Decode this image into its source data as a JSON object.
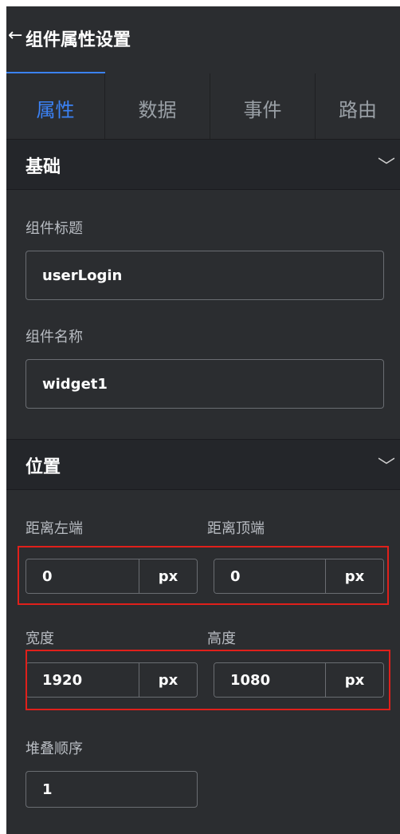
{
  "header": {
    "back_icon": "←",
    "title": "组件属性设置"
  },
  "tabs": [
    {
      "label": "属性",
      "active": true
    },
    {
      "label": "数据",
      "active": false
    },
    {
      "label": "事件",
      "active": false
    },
    {
      "label": "路由",
      "active": false
    }
  ],
  "sections": {
    "basic": {
      "title": "基础",
      "chevron": "﹀",
      "component_title_label": "组件标题",
      "component_title_value": "userLogin",
      "component_name_label": "组件名称",
      "component_name_value": "widget1"
    },
    "position": {
      "title": "位置",
      "chevron": "﹀",
      "left_label": "距离左端",
      "left_value": "0",
      "left_unit": "px",
      "top_label": "距离顶端",
      "top_value": "0",
      "top_unit": "px",
      "width_label": "宽度",
      "width_value": "1920",
      "width_unit": "px",
      "height_label": "高度",
      "height_value": "1080",
      "height_unit": "px",
      "zindex_label": "堆叠顺序",
      "zindex_value": "1"
    }
  },
  "colors": {
    "panel_bg": "#2b2d30",
    "accent": "#3b82f6",
    "highlight": "#e0201b"
  }
}
